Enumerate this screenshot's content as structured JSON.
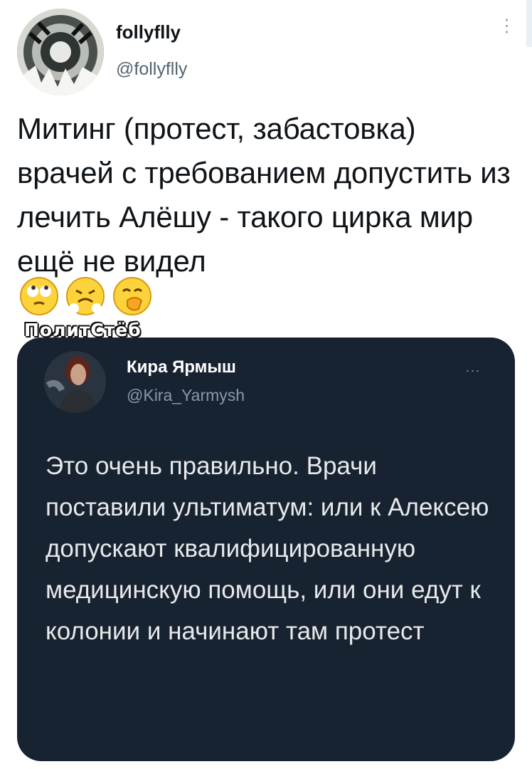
{
  "tweet": {
    "author_name": "follyflly",
    "author_handle": "@follyflly",
    "text": "Митинг (протест, забастовка) врачей с требованием допустить из лечить Алёшу - такого цирка мир ещё не видел",
    "emojis": [
      "face-with-rolling-eyes-icon",
      "face-with-steam-from-nose-icon",
      "face-with-hand-over-mouth-icon"
    ]
  },
  "watermark": "ПолитСтёб",
  "quoted_tweet": {
    "author_name": "Кира Ярмыш",
    "author_handle": "@Kira_Yarmysh",
    "menu": "...",
    "text": "Это очень правильно. Врачи поставили ультиматум: или к Алексею допускают квалифицированную медицинскую помощь, или они едут к колонии и начинают там протест"
  },
  "colors": {
    "primary_text": "#0f1419",
    "secondary_text": "#536471",
    "quote_background": "#172331",
    "quote_text": "#e7e9ea"
  }
}
